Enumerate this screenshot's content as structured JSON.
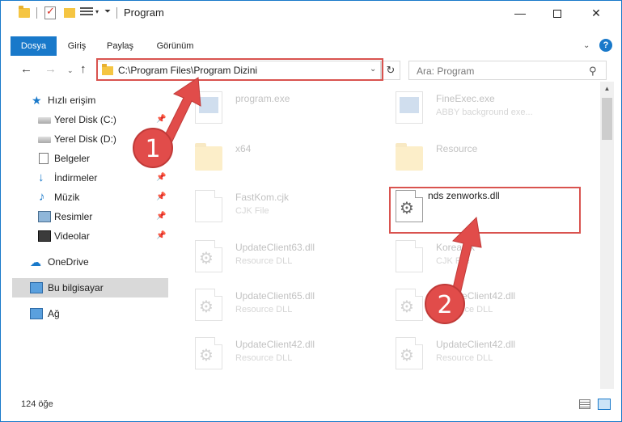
{
  "window": {
    "title": "Program"
  },
  "ribbon": {
    "tabs": [
      "Dosya",
      "Giriş",
      "Paylaş",
      "Görünüm"
    ]
  },
  "address": {
    "path": "C:\\Program Files\\Program Dizini"
  },
  "search": {
    "placeholder": "Ara: Program"
  },
  "sidebar": {
    "items": [
      {
        "label": "Hızlı erişim",
        "icon": "star-icon"
      },
      {
        "label": "Yerel Disk (C:)",
        "icon": "drive-icon",
        "pinned": true
      },
      {
        "label": "Yerel Disk (D:)",
        "icon": "drive-icon"
      },
      {
        "label": "Belgeler",
        "icon": "documents-icon",
        "pinned": true
      },
      {
        "label": "İndirmeler",
        "icon": "downloads-icon",
        "pinned": true
      },
      {
        "label": "Müzik",
        "icon": "music-icon",
        "pinned": true
      },
      {
        "label": "Resimler",
        "icon": "pictures-icon",
        "pinned": true
      },
      {
        "label": "Videolar",
        "icon": "videos-icon",
        "pinned": true
      },
      {
        "label": "OneDrive",
        "icon": "cloud-icon"
      },
      {
        "label": "Bu bilgisayar",
        "icon": "pc-icon",
        "selected": true
      },
      {
        "label": "Ağ",
        "icon": "network-icon"
      }
    ]
  },
  "files": [
    {
      "name": "program.exe",
      "type": "",
      "icon": "exe-icon",
      "faded": true
    },
    {
      "name": "FineExec.exe",
      "type": "ABBY background exe...",
      "icon": "exe-icon",
      "faded": true
    },
    {
      "name": "x64",
      "type": "",
      "icon": "folder-icon",
      "faded": true
    },
    {
      "name": "Resource",
      "type": "",
      "icon": "folder-icon",
      "faded": true
    },
    {
      "name": "FastKom.cjk",
      "type": "CJK File",
      "icon": "file-icon",
      "faded": true
    },
    {
      "name": "nds zenworks.dll",
      "type": "",
      "icon": "dll-icon",
      "faded": false
    },
    {
      "name": "UpdateClient63.dll",
      "type": "Resource DLL",
      "icon": "dll-icon",
      "faded": true
    },
    {
      "name": "Korea...k",
      "type": "CJK File",
      "icon": "file-icon",
      "faded": true
    },
    {
      "name": "UpdateClient65.dll",
      "type": "Resource DLL",
      "icon": "dll-icon",
      "faded": true
    },
    {
      "name": "UpdateClient42.dll",
      "type": "Resource DLL",
      "icon": "dll-icon",
      "faded": true
    },
    {
      "name": "UpdateClient42.dll",
      "type": "Resource DLL",
      "icon": "dll-icon",
      "faded": true
    },
    {
      "name": "UpdateClient42.dll",
      "type": "Resource DLL",
      "icon": "dll-icon",
      "faded": true
    }
  ],
  "status": {
    "count": "124 öğe"
  },
  "callouts": [
    "1",
    "2"
  ],
  "colors": {
    "accent": "#1979ca",
    "callout": "#e14c4a"
  }
}
